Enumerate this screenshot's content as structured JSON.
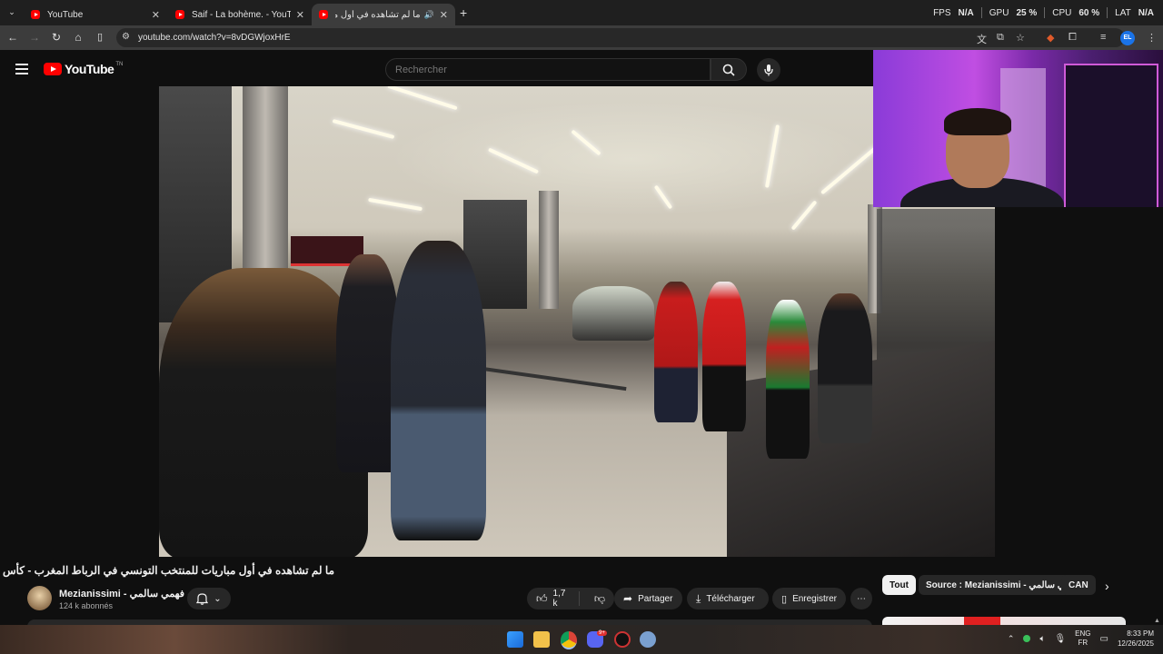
{
  "browser": {
    "tabs": [
      {
        "title": "YouTube"
      },
      {
        "title": "Saif - La bohème. - YouTube"
      },
      {
        "title": "ما لم تشاهده في أول مباراة"
      }
    ],
    "new_tab": "+",
    "address": "youtube.com/watch?v=8vDGWjoxHrE",
    "perf": {
      "fps_label": "FPS",
      "fps": "N/A",
      "gpu_label": "GPU",
      "gpu": "25 %",
      "cpu_label": "CPU",
      "cpu": "60 %",
      "lat_label": "LAT",
      "lat": "N/A"
    },
    "profile": "EL"
  },
  "youtube": {
    "logo": "YouTube",
    "logo_sup": "TN",
    "search_placeholder": "Rechercher"
  },
  "video": {
    "title": "ما لم تشاهده في أول مباريات للمنتخب التونسي في الرباط المغرب - كأس إفريقيا",
    "channel": "Mezianissimi - فهمي سالمي",
    "subscribers": "124 k abonnés",
    "likes": "1,7 k",
    "share": "Partager",
    "download": "Télécharger",
    "save": "Enregistrer",
    "more": "⋯"
  },
  "chips": {
    "all": "Tout",
    "source": "Source : Mezianissimi - فهمي سالمي",
    "can": "CAN"
  },
  "taskbar": {
    "lang_top": "ENG",
    "lang_bottom": "FR",
    "time": "8:33 PM",
    "date": "12/26/2025",
    "discord_badge": "9+"
  },
  "colors": {
    "accent_red": "#ff0000",
    "bg": "#0f0f0f"
  }
}
